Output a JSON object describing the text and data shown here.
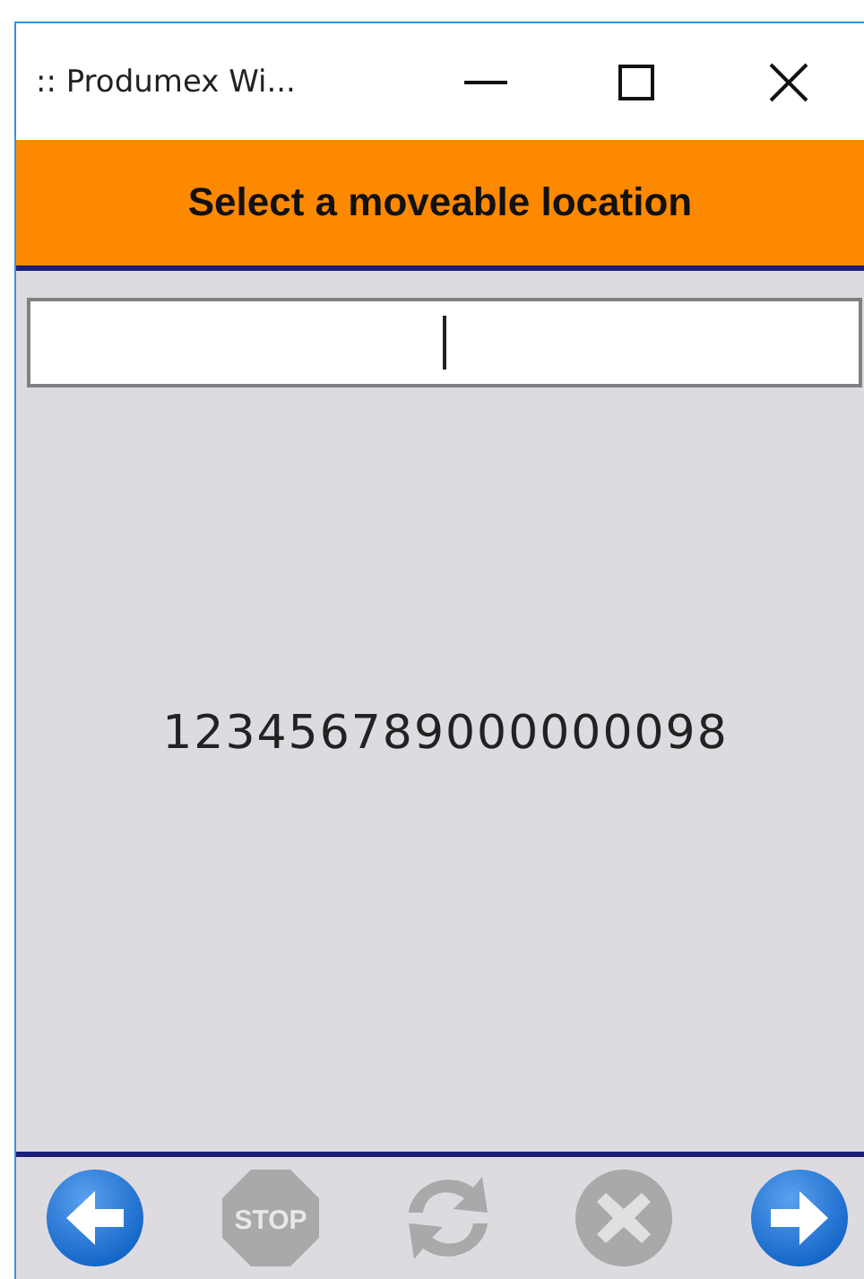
{
  "window": {
    "title": ":: Produmex Wi..."
  },
  "header": {
    "title": "Select a moveable location"
  },
  "message": "123456789000000098",
  "toolbar": {
    "buttons": [
      {
        "kind": "back",
        "disabled": false
      },
      {
        "kind": "stop",
        "label": "STOP",
        "disabled": true
      },
      {
        "kind": "refresh",
        "disabled": true
      },
      {
        "kind": "cancel",
        "disabled": true
      },
      {
        "kind": "forward",
        "disabled": false
      }
    ]
  }
}
